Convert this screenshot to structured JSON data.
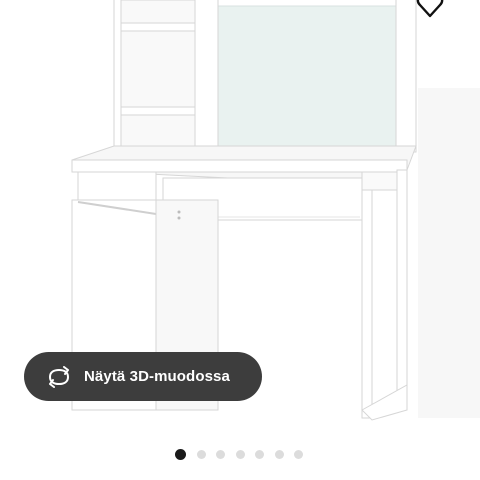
{
  "product_image": {
    "icon": "desk-with-hutch-illustration"
  },
  "favourite": {
    "icon": "heart-outline-icon"
  },
  "view_3d_button": {
    "label": "Näytä 3D-muodossa",
    "icon": "rotate-3d-icon",
    "background": "#3d3d3d",
    "text_color": "#ffffff"
  },
  "carousel": {
    "total": 7,
    "active_index": 0,
    "active_color": "#1a1a1a",
    "inactive_color": "#dcdcdc"
  }
}
